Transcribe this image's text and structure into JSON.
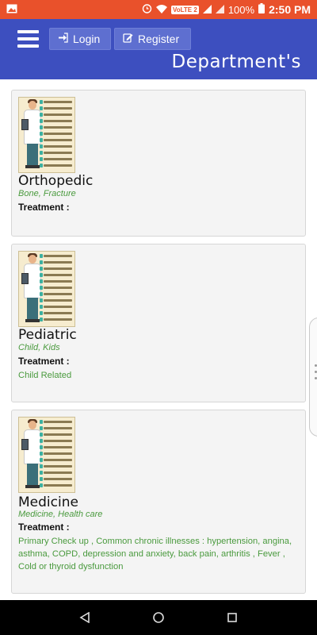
{
  "status_bar": {
    "network_badge": "VoLTE 2",
    "battery": "100%",
    "time": "2:50 PM"
  },
  "header": {
    "login_label": "Login",
    "register_label": "Register",
    "title": "Department's"
  },
  "departments": [
    {
      "name": "Orthopedic",
      "keywords": "Bone, Fracture",
      "treatment_label": "Treatment :",
      "treatment_text": ""
    },
    {
      "name": "Pediatric",
      "keywords": "Child, Kids",
      "treatment_label": "Treatment :",
      "treatment_text": "Child Related"
    },
    {
      "name": "Medicine",
      "keywords": "Medicine, Health care",
      "treatment_label": "Treatment :",
      "treatment_text": "Primary Check up , Common chronic illnesses : hypertension, angina, asthma, COPD, depression and anxiety, back pain, arthritis , Fever , Cold or thyroid dysfunction"
    }
  ],
  "colors": {
    "status_bar": "#e9512b",
    "app_bar": "#3d4fbf",
    "header_button": "#5e6fd0",
    "keyword_green": "#4a9a3e",
    "card_bg": "#f4f4f4"
  },
  "icons": {
    "menu": "hamburger-icon",
    "login": "sign-in-icon",
    "register": "edit-icon",
    "nav_back": "back-triangle-icon",
    "nav_home": "home-circle-icon",
    "nav_recent": "recent-square-icon"
  }
}
